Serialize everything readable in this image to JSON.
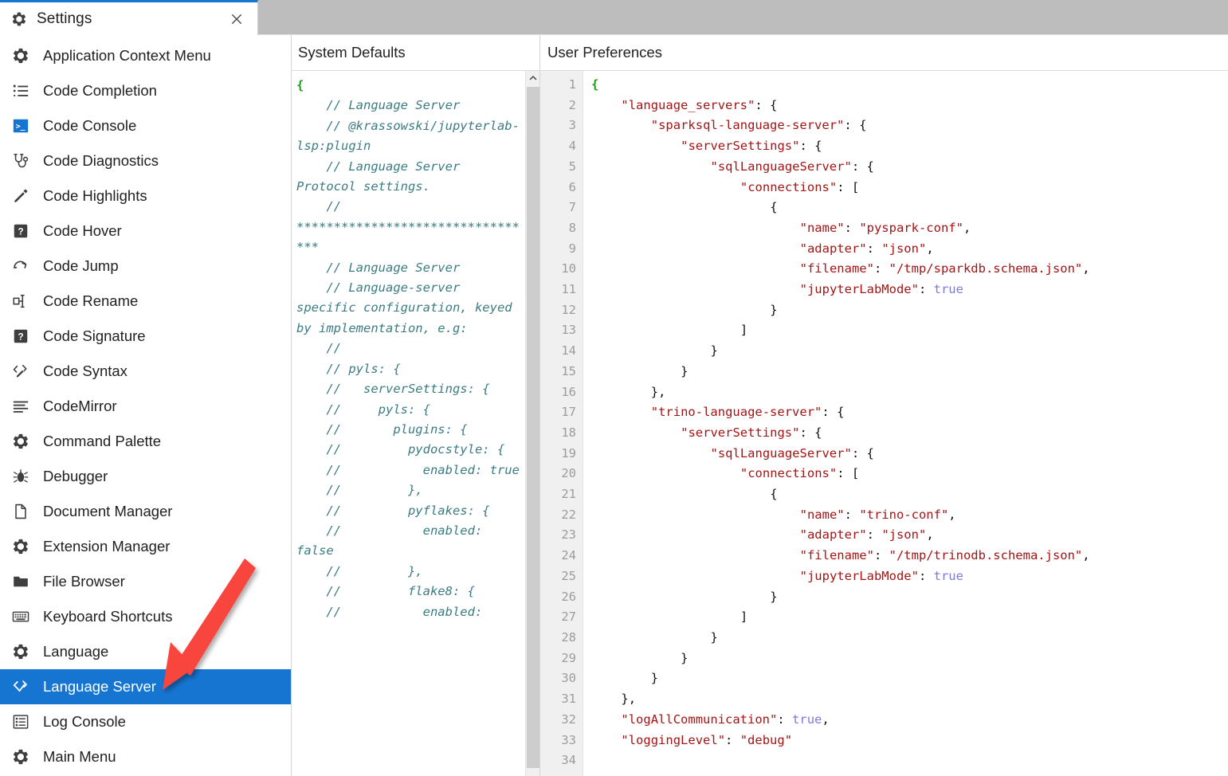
{
  "window": {
    "tab_title": "Settings",
    "tab_icon": "gear-icon",
    "close_icon": "close-icon",
    "accent_color": "#1976d2",
    "tabbar_background": "#bdbdbd"
  },
  "sidebar": {
    "selected_color": "#1675d1",
    "items": [
      {
        "label": "Application Context Menu",
        "icon": "gear-icon",
        "selected": false
      },
      {
        "label": "Code Completion",
        "icon": "list-icon",
        "selected": false
      },
      {
        "label": "Code Console",
        "icon": "terminal-icon",
        "selected": false
      },
      {
        "label": "Code Diagnostics",
        "icon": "stethoscope-icon",
        "selected": false
      },
      {
        "label": "Code Highlights",
        "icon": "marker-icon",
        "selected": false
      },
      {
        "label": "Code Hover",
        "icon": "question-box-icon",
        "selected": false
      },
      {
        "label": "Code Jump",
        "icon": "jump-arrow-icon",
        "selected": false
      },
      {
        "label": "Code Rename",
        "icon": "rename-icon",
        "selected": false
      },
      {
        "label": "Code Signature",
        "icon": "question-box-icon",
        "selected": false
      },
      {
        "label": "Code Syntax",
        "icon": "code-pen-icon",
        "selected": false
      },
      {
        "label": "CodeMirror",
        "icon": "lines-icon",
        "selected": false
      },
      {
        "label": "Command Palette",
        "icon": "gear-icon",
        "selected": false
      },
      {
        "label": "Debugger",
        "icon": "bug-icon",
        "selected": false
      },
      {
        "label": "Document Manager",
        "icon": "file-icon",
        "selected": false
      },
      {
        "label": "Extension Manager",
        "icon": "gear-icon",
        "selected": false
      },
      {
        "label": "File Browser",
        "icon": "folder-icon",
        "selected": false
      },
      {
        "label": "Keyboard Shortcuts",
        "icon": "keyboard-icon",
        "selected": false
      },
      {
        "label": "Language",
        "icon": "gear-icon",
        "selected": false
      },
      {
        "label": "Language Server",
        "icon": "code-check-icon",
        "selected": true
      },
      {
        "label": "Log Console",
        "icon": "log-list-icon",
        "selected": false
      },
      {
        "label": "Main Menu",
        "icon": "gear-icon",
        "selected": false
      }
    ]
  },
  "system_defaults": {
    "title": "System Defaults",
    "scrollbar_up_icon": "chevron-up-icon",
    "lines": [
      {
        "type": "brace",
        "text": "{"
      },
      {
        "type": "comment",
        "text": "    // Language Server"
      },
      {
        "type": "comment",
        "text": "    // @krassowski/jupyterlab-lsp:plugin"
      },
      {
        "type": "comment",
        "text": "    // Language Server Protocol settings."
      },
      {
        "type": "comment",
        "text": "    // *********************************"
      },
      {
        "type": "comment",
        "text": ""
      },
      {
        "type": "comment",
        "text": "    // Language Server"
      },
      {
        "type": "comment",
        "text": "    // Language-server specific configuration, keyed by implementation, e.g:"
      },
      {
        "type": "comment",
        "text": "    //"
      },
      {
        "type": "comment",
        "text": "    // pyls: {"
      },
      {
        "type": "comment",
        "text": "    //   serverSettings: {"
      },
      {
        "type": "comment",
        "text": "    //     pyls: {"
      },
      {
        "type": "comment",
        "text": "    //       plugins: {"
      },
      {
        "type": "comment",
        "text": "    //         pydocstyle: {"
      },
      {
        "type": "comment",
        "text": "    //           enabled: true"
      },
      {
        "type": "comment",
        "text": "    //         },"
      },
      {
        "type": "comment",
        "text": "    //         pyflakes: {"
      },
      {
        "type": "comment",
        "text": "    //           enabled: false"
      },
      {
        "type": "comment",
        "text": "    //         },"
      },
      {
        "type": "comment",
        "text": "    //         flake8: {"
      },
      {
        "type": "comment",
        "text": "    //           enabled:"
      }
    ]
  },
  "user_preferences": {
    "title": "User Preferences",
    "line_numbers": [
      1,
      2,
      3,
      4,
      5,
      6,
      7,
      8,
      9,
      10,
      11,
      12,
      13,
      14,
      15,
      16,
      17,
      18,
      19,
      20,
      21,
      22,
      23,
      24,
      25,
      26,
      27,
      28,
      29,
      30,
      31,
      32,
      33,
      34
    ],
    "code_lines": [
      "{",
      "    \"language_servers\": {",
      "        \"sparksql-language-server\": {",
      "            \"serverSettings\": {",
      "                \"sqlLanguageServer\": {",
      "                    \"connections\": [",
      "                        {",
      "                            \"name\": \"pyspark-conf\",",
      "                            \"adapter\": \"json\",",
      "                            \"filename\": \"/tmp/sparkdb.schema.json\",",
      "                            \"jupyterLabMode\": true",
      "                        }",
      "                    ]",
      "                }",
      "            }",
      "        },",
      "        \"trino-language-server\": {",
      "            \"serverSettings\": {",
      "                \"sqlLanguageServer\": {",
      "                    \"connections\": [",
      "                        {",
      "                            \"name\": \"trino-conf\",",
      "                            \"adapter\": \"json\",",
      "                            \"filename\": \"/tmp/trinodb.schema.json\",",
      "                            \"jupyterLabMode\": true",
      "                        }",
      "                    ]",
      "                }",
      "            }",
      "        }",
      "    },",
      "    \"logAllCommunication\": true,",
      "    \"loggingLevel\": \"debug\"",
      ""
    ]
  },
  "annotation": {
    "arrow_color": "#f8453c",
    "arrow_name": "red-pointer-arrow",
    "points_at": "Language Server"
  }
}
